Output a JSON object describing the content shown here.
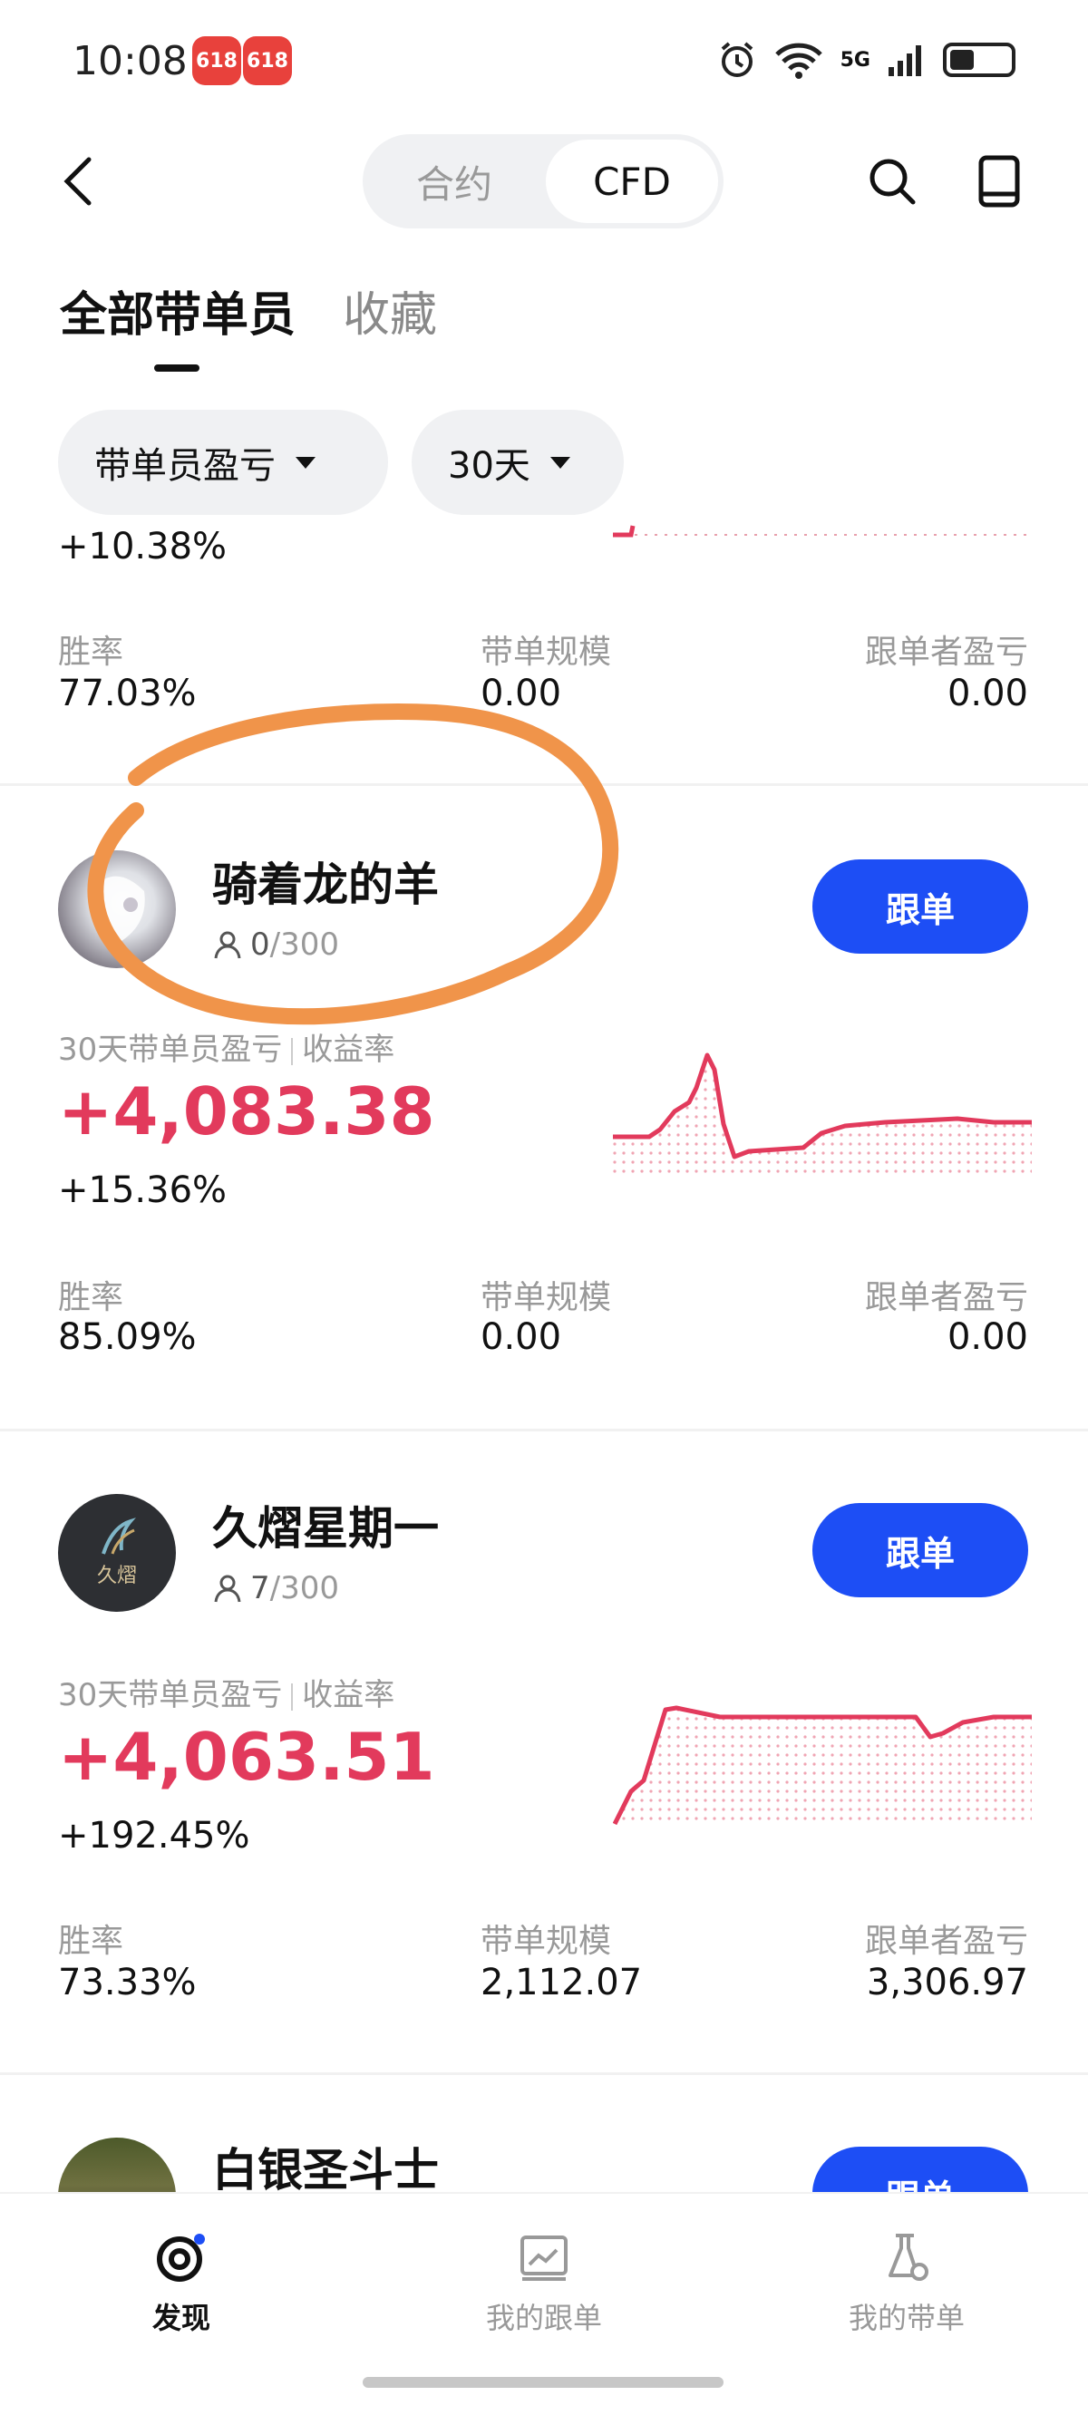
{
  "status_bar": {
    "time": "10:08",
    "badge_1": "618",
    "badge_2": "618",
    "network": "5G",
    "wifi_label": "6"
  },
  "header": {
    "segment_options": [
      "合约",
      "CFD"
    ],
    "selected": "CFD"
  },
  "tabs": {
    "all": "全部带单员",
    "favorites": "收藏"
  },
  "filters": {
    "sort": "带单员盈亏",
    "period": "30天"
  },
  "labels": {
    "win_rate": "胜率",
    "scale": "带单规模",
    "follower_pnl": "跟单者盈亏",
    "pnl_title": "30天带单员盈亏",
    "yield_title": "收益率",
    "follow": "跟单"
  },
  "colors": {
    "accent": "#1d4ef5",
    "profit": "#e23a5c",
    "annotation": "#f0944a"
  },
  "cards": [
    {
      "rate": "+10.38%",
      "win_rate": "77.03%",
      "scale": "0.00",
      "follower_pnl": "0.00"
    },
    {
      "name": "骑着龙的羊",
      "followers_current": "0",
      "followers_max": "/300",
      "pnl": "+4,083.38",
      "rate": "+15.36%",
      "win_rate": "85.09%",
      "scale": "0.00",
      "follower_pnl": "0.00"
    },
    {
      "name": "久熠星期一",
      "avatar_text": "久熠",
      "followers_current": "7",
      "followers_max": "/300",
      "pnl": "+4,063.51",
      "rate": "+192.45%",
      "win_rate": "73.33%",
      "scale": "2,112.07",
      "follower_pnl": "3,306.97"
    },
    {
      "name": "白银圣斗士",
      "follow": "跟单"
    }
  ],
  "bottom_nav": [
    {
      "label": "发现",
      "icon": "discover-icon",
      "active": true
    },
    {
      "label": "我的跟单",
      "icon": "chart-icon",
      "active": false
    },
    {
      "label": "我的带单",
      "icon": "flask-icon",
      "active": false
    }
  ]
}
